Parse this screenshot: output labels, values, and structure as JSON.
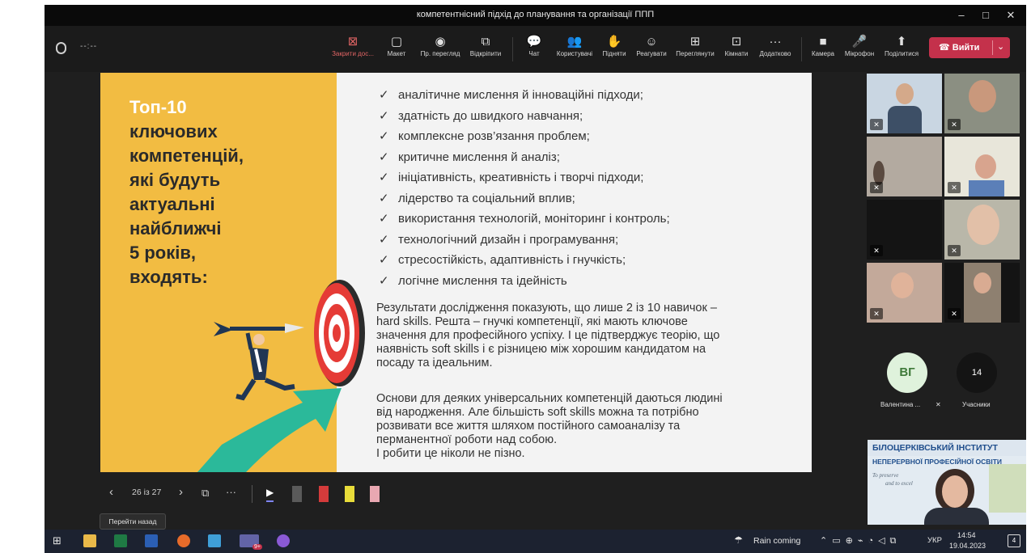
{
  "window": {
    "title": "компетентнісний підхід до планування та організації ППП",
    "controls": [
      "–",
      "□",
      "✕"
    ]
  },
  "toolbar": {
    "timer": "--:--",
    "buttons": [
      {
        "label": "Закрити дос...",
        "icon": "close-share-icon",
        "glyph": "⊠"
      },
      {
        "label": "Макет",
        "icon": "layout-icon",
        "glyph": "▢"
      },
      {
        "label": "Пр. перегляд",
        "icon": "eye-icon",
        "glyph": "◉"
      },
      {
        "label": "Відкріпити",
        "icon": "popout-icon",
        "glyph": "⧉"
      },
      {
        "label": "Чат",
        "icon": "chat-icon",
        "glyph": "💬"
      },
      {
        "label": "Користувачі",
        "icon": "people-icon",
        "glyph": "👥"
      },
      {
        "label": "Підняти",
        "icon": "raise-hand-icon",
        "glyph": "✋"
      },
      {
        "label": "Реагувати",
        "icon": "react-icon",
        "glyph": "☺"
      },
      {
        "label": "Переглянути",
        "icon": "view-icon",
        "glyph": "⊞"
      },
      {
        "label": "Кімнати",
        "icon": "rooms-icon",
        "glyph": "⊡"
      },
      {
        "label": "Додатково",
        "icon": "more-icon",
        "glyph": "···"
      },
      {
        "label": "Камера",
        "icon": "camera-icon",
        "glyph": "■"
      },
      {
        "label": "Мікрофон",
        "icon": "microphone-icon",
        "glyph": "🎤"
      },
      {
        "label": "Поділитися",
        "icon": "share-icon",
        "glyph": "⬆"
      }
    ],
    "leave_label": "Вийти"
  },
  "slide": {
    "heading_lines": [
      "Топ-10",
      "ключових",
      "компетенцій,",
      "які будуть",
      "актуальні",
      "найближчі",
      "5 років,",
      "входять:"
    ],
    "skills": [
      "аналітичне мислення й інноваційні підходи;",
      "здатність до швидкого навчання;",
      "комплексне розв’язання проблем;",
      "критичне мислення й аналіз;",
      "ініціативність, креативність і творчі підходи;",
      "лідерство та соціальний вплив;",
      "використання технологій, моніторинг і контроль;",
      "технологічний дизайн і програмування;",
      "стресостійкість, адаптивність і гнучкість;",
      "логічне мислення та ідейність"
    ],
    "paragraph1": [
      "Результати дослідження показують, що лише 2 із 10 навичок –",
      "hard skills. Решта – гнучкі компетенції, які мають ключове",
      "значення для професійного успіху. І це підтверджує теорію, що",
      "наявність soft skills і є різницею між хорошим кандидатом на",
      "посаду та ідеальним."
    ],
    "paragraph2": [
      "Основи для деяких універсальних компетенцій даються людині",
      "від народження. Але більшість soft skills можна та потрібно",
      "розвивати все життя шляхом постійного самоаналізу та",
      "перманентної роботи над собою.",
      "І робити це ніколи не пізно."
    ]
  },
  "presenter": {
    "page_indicator": "26 із 27",
    "tooltip": "Перейти назад"
  },
  "participants": {
    "avatar_initials": "ВГ",
    "avatar_name": "Валентина ...",
    "count": "14",
    "count_label": "Учасники",
    "banner_line1": "БІЛОЦЕРКІВСЬКИЙ ІНСТИТУТ",
    "banner_line2": "НЕПЕРЕРВНОЇ ПРОФЕСІЙНОЇ ОСВІТИ",
    "banner_motto1": "To preserve",
    "banner_motto2": "and to excel"
  },
  "taskbar": {
    "weather": "Rain coming",
    "language": "УКР",
    "time": "14:54",
    "date": "19.04.2023",
    "notifications": "4",
    "teams_badge": "9+"
  },
  "colors": {
    "slide_yellow": "#f2bc42",
    "leave_red": "#c4314b",
    "toolbar_bg": "#1b1b1b",
    "taskbar_bg": "#1c2230"
  }
}
